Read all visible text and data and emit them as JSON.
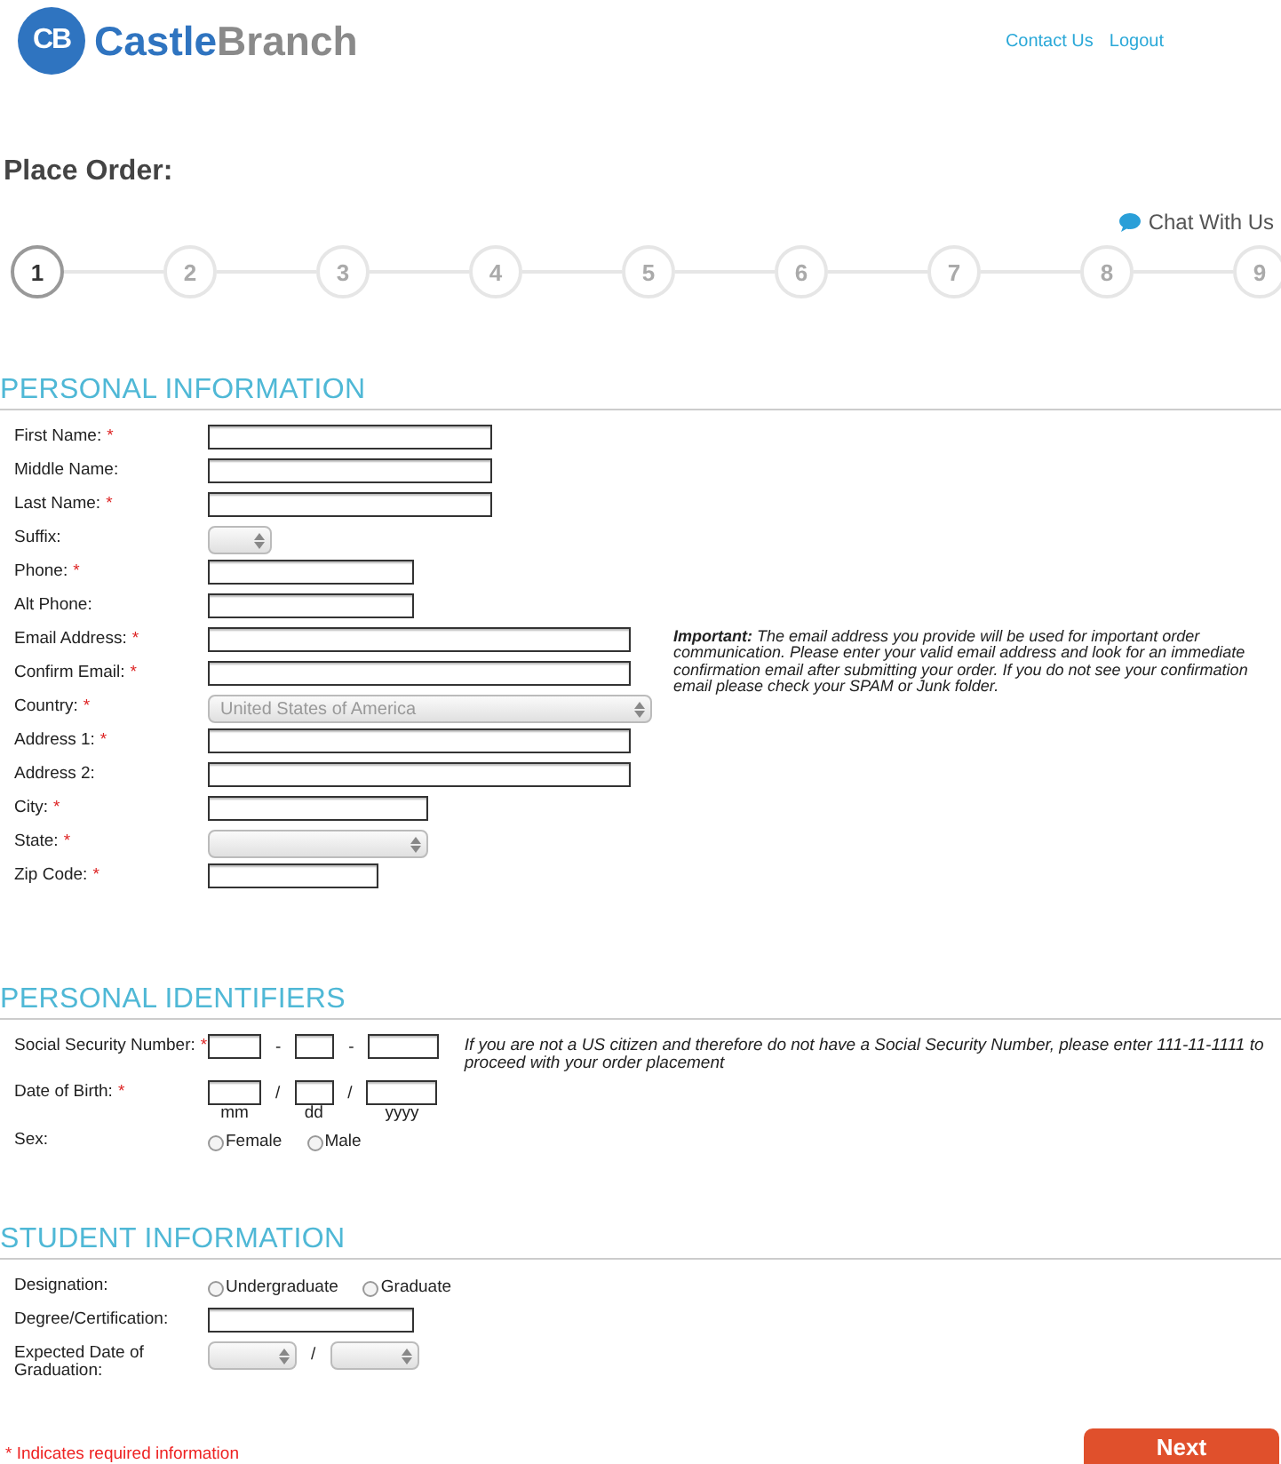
{
  "header": {
    "logo": {
      "mark": "CB",
      "name_first": "Castle",
      "name_second": "Branch"
    },
    "links": [
      "Contact Us",
      "Logout"
    ]
  },
  "page_title": "Place Order:",
  "chat_link": "Chat With Us",
  "steps": [
    {
      "label": "1",
      "selected": true
    },
    {
      "label": "2",
      "selected": false
    },
    {
      "label": "3",
      "selected": false
    },
    {
      "label": "4",
      "selected": false
    },
    {
      "label": "5",
      "selected": false
    },
    {
      "label": "6",
      "selected": false
    },
    {
      "label": "7",
      "selected": false
    },
    {
      "label": "8",
      "selected": false
    },
    {
      "label": "9",
      "selected": false
    }
  ],
  "sections": [
    {
      "title": "PERSONAL INFORMATION",
      "note": "**Important:** The email address you provide will be used for important order communication. Please enter your valid email address and look for an immediate confirmation email after submitting your order. If you do not see your confirmation email please check your SPAM or Junk folder.",
      "rows": [
        {
          "kind": "text",
          "label": "First Name:",
          "required_mark": "*"
        },
        {
          "kind": "text",
          "label": "Middle Name:"
        },
        {
          "kind": "text",
          "label": "Last Name:",
          "required_mark": "*"
        },
        {
          "kind": "select",
          "label": "Suffix:"
        },
        {
          "kind": "text",
          "label": "Phone:",
          "required_mark": "*"
        },
        {
          "kind": "text",
          "label": "Alt Phone:"
        },
        {
          "kind": "text",
          "label": "Email Address:",
          "required_mark": "*"
        },
        {
          "kind": "text",
          "label": "Confirm Email:",
          "required_mark": "*"
        },
        {
          "kind": "select",
          "label": "Country:",
          "required_mark": "*",
          "value": "United States of America"
        },
        {
          "kind": "text",
          "label": "Address 1:",
          "required_mark": "*"
        },
        {
          "kind": "text",
          "label": "Address 2:"
        },
        {
          "kind": "text",
          "label": "City:",
          "required_mark": "*"
        },
        {
          "kind": "select",
          "label": "State:",
          "required_mark": "*"
        },
        {
          "kind": "text",
          "label": "Zip Code:",
          "required_mark": "*"
        }
      ]
    },
    {
      "title": "PERSONAL IDENTIFIERS",
      "rows": [
        {
          "kind": "split",
          "label": "Social Security Number:",
          "required_mark": "*",
          "separators": [
            "-",
            "-"
          ],
          "note": "If you are not a US citizen and therefore do not have a Social Security Number, please enter 111-11-1111 to proceed with your order placement"
        },
        {
          "kind": "split",
          "label": "Date of Birth:",
          "required_mark": "*",
          "separators": [
            "/",
            "/"
          ],
          "captions": [
            "mm",
            "dd",
            "yyyy"
          ]
        },
        {
          "kind": "radio",
          "label": "Sex:",
          "options": [
            {
              "label": "Female",
              "selected": false
            },
            {
              "label": "Male",
              "selected": false
            }
          ]
        }
      ]
    },
    {
      "title": "STUDENT INFORMATION",
      "rows": [
        {
          "kind": "radio",
          "label": "Designation:",
          "options": [
            {
              "label": "Undergraduate",
              "selected": false
            },
            {
              "label": "Graduate",
              "selected": false
            }
          ]
        },
        {
          "kind": "text",
          "label": "Degree/Certification:"
        },
        {
          "kind": "selects",
          "label": "Expected Date of Graduation:",
          "separators": [
            "/"
          ]
        }
      ]
    }
  ],
  "footer": {
    "required_note": "* Indicates required information",
    "next_button": "Next"
  }
}
